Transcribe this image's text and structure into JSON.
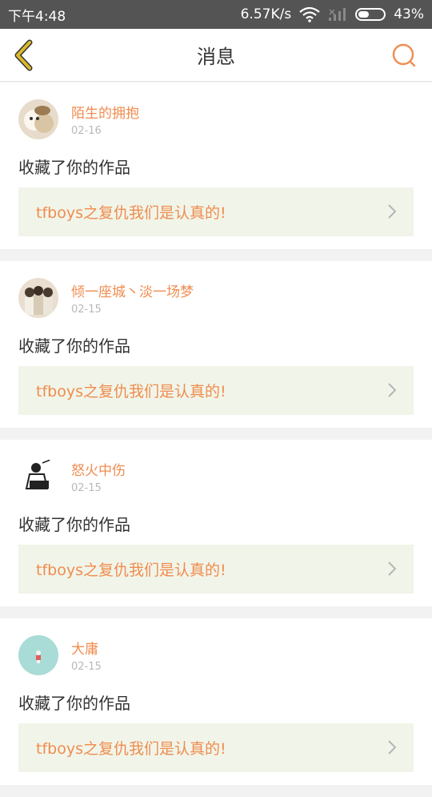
{
  "status_bar": {
    "time": "下午4:48",
    "network_speed": "6.57K/s",
    "battery_percent": "43%",
    "battery_level": 0.43
  },
  "header": {
    "title": "消息",
    "back_icon": "chevron-left-icon",
    "search_icon": "search-icon"
  },
  "colors": {
    "accent": "#f08c4f",
    "back_arrow": "#c9a820",
    "link_bg": "#f1f5e9",
    "status_bar_bg": "#545454"
  },
  "messages": [
    {
      "username": "陌生的拥抱",
      "date": "02-16",
      "action": "收藏了你的作品",
      "work_title": "tfboys之复仇我们是认真的!"
    },
    {
      "username": "倾一座城丶淡一场梦",
      "date": "02-15",
      "action": "收藏了你的作品",
      "work_title": "tfboys之复仇我们是认真的!"
    },
    {
      "username": "怒火中伤",
      "date": "02-15",
      "action": "收藏了你的作品",
      "work_title": "tfboys之复仇我们是认真的!"
    },
    {
      "username": "大庸",
      "date": "02-15",
      "action": "收藏了你的作品",
      "work_title": "tfboys之复仇我们是认真的!"
    }
  ]
}
